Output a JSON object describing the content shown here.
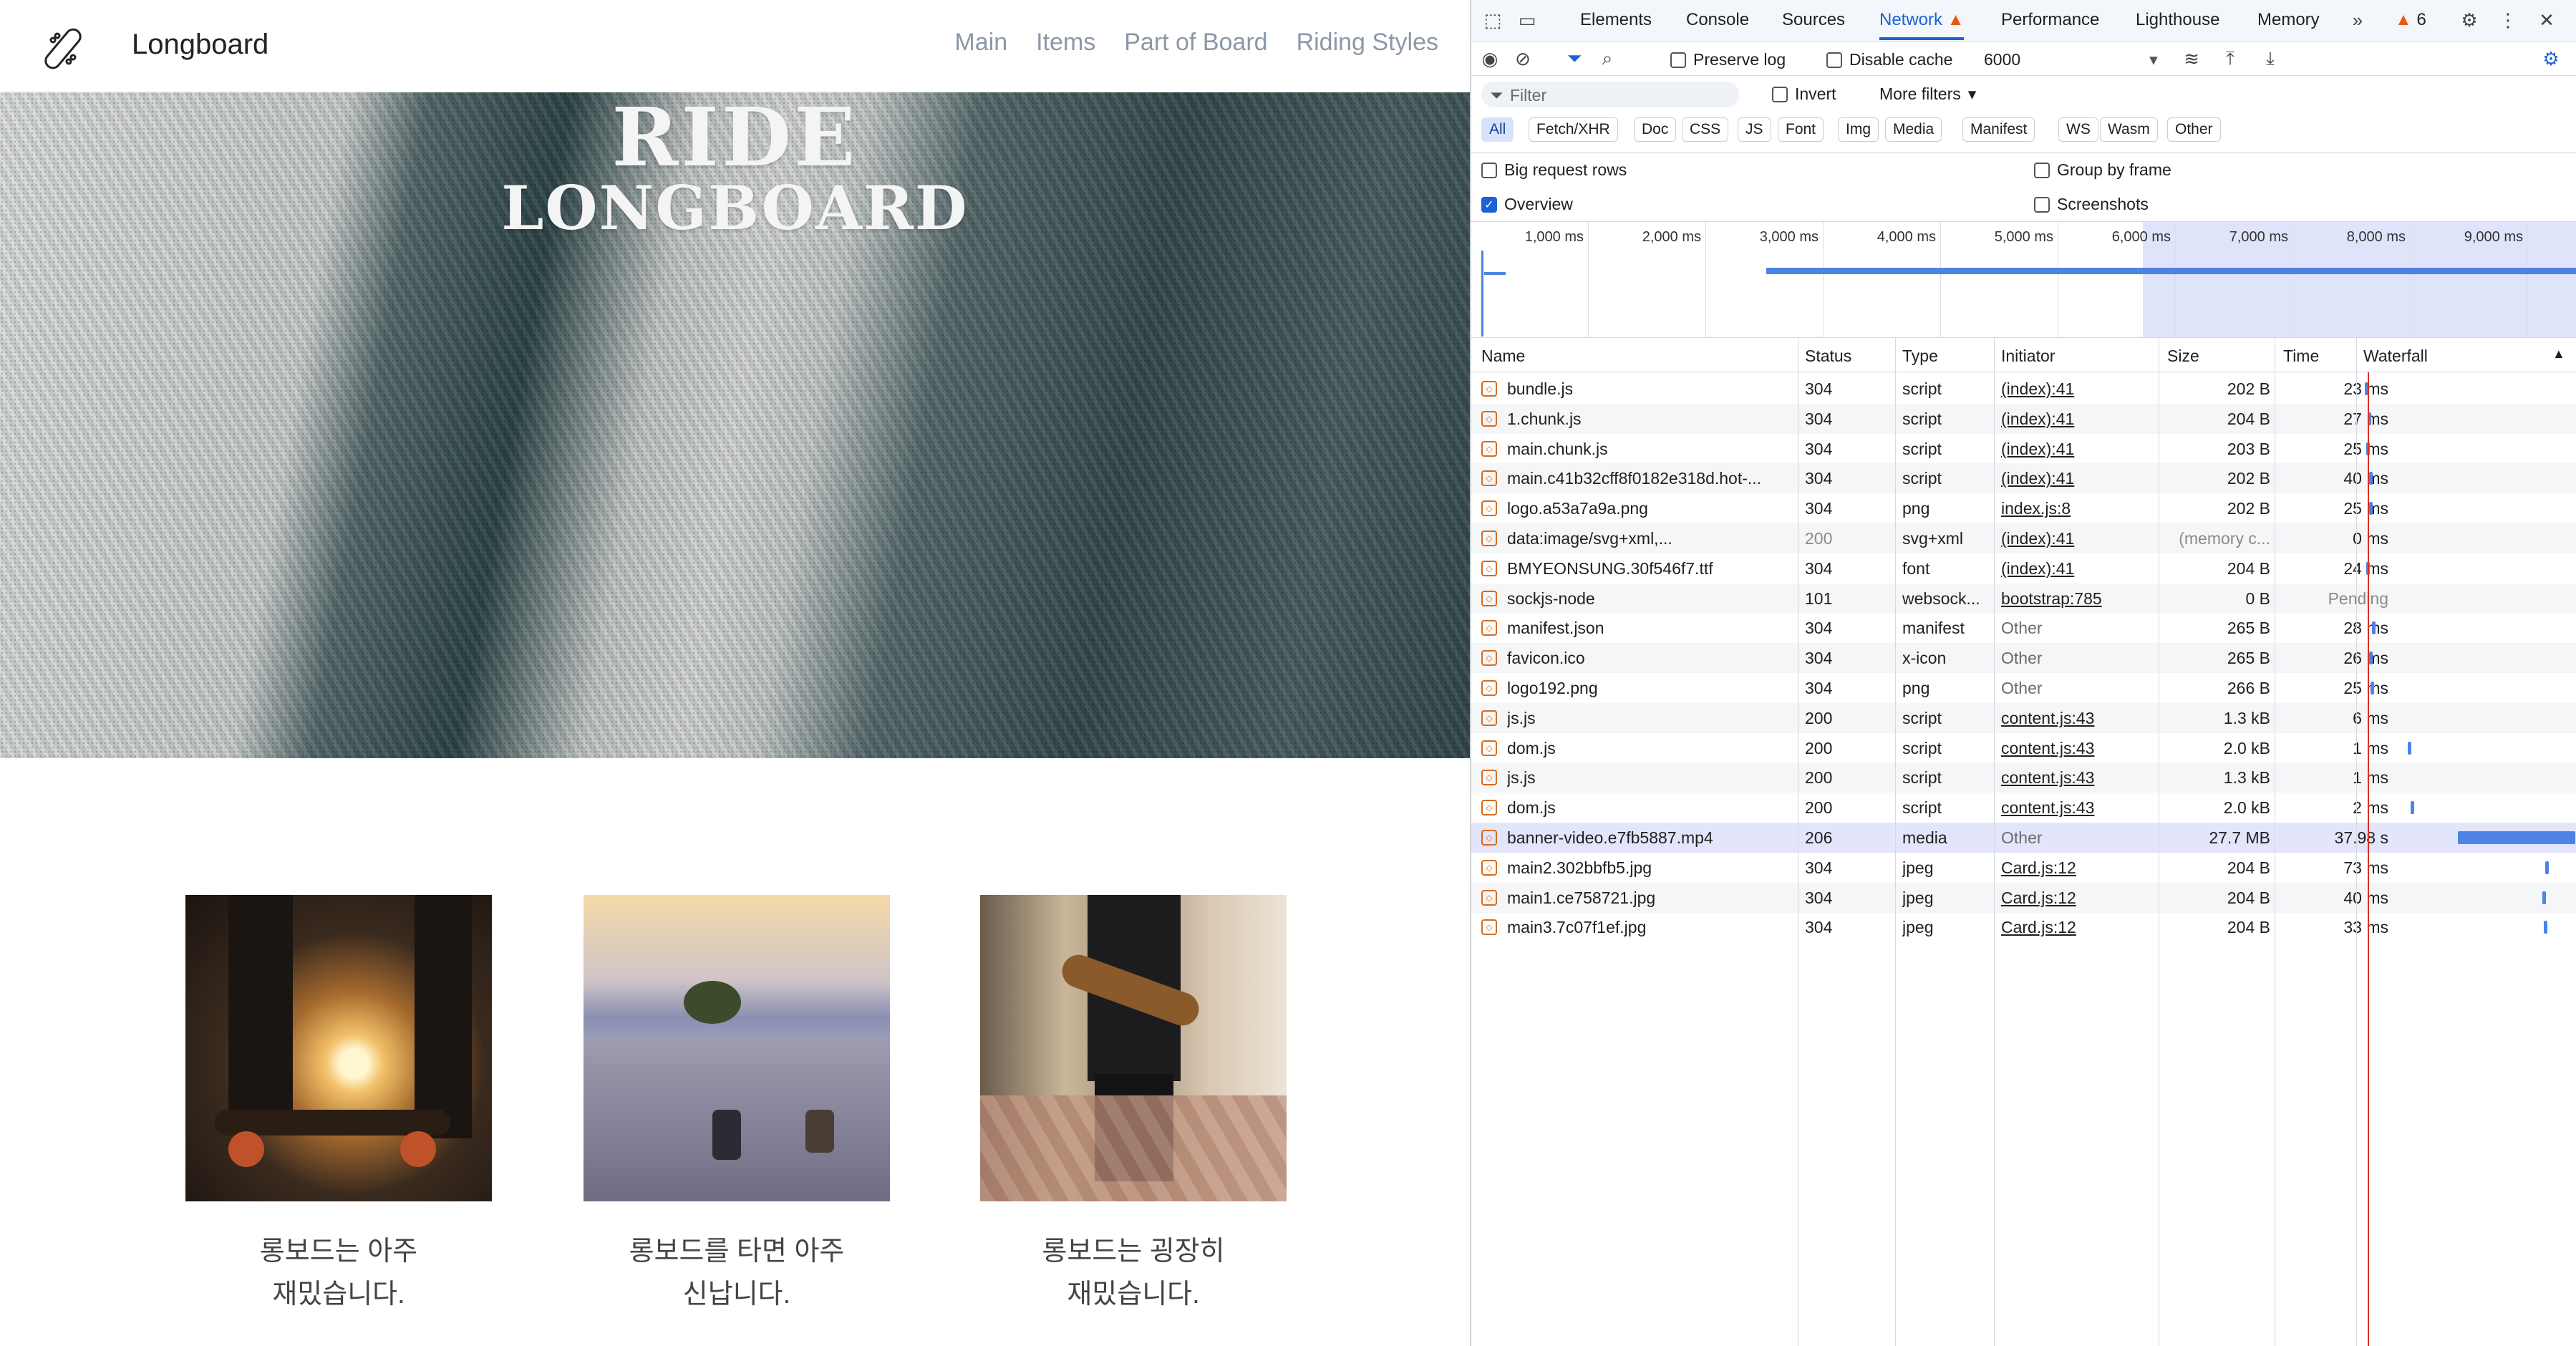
{
  "site": {
    "brand": "Longboard",
    "nav": [
      "Main",
      "Items",
      "Part of Board",
      "Riding Styles"
    ],
    "hero_line1": "RIDE",
    "hero_line2": "LONGBOARD",
    "cards": [
      {
        "caption_line1": "롱보드는 아주",
        "caption_line2": "재밌습니다."
      },
      {
        "caption_line1": "롱보드를 타면 아주",
        "caption_line2": "신납니다."
      },
      {
        "caption_line1": "롱보드는 굉장히",
        "caption_line2": "재밌습니다."
      }
    ]
  },
  "devtools": {
    "tabs": [
      "Elements",
      "Console",
      "Sources",
      "Network",
      "Performance",
      "Lighthouse",
      "Memory"
    ],
    "active_tab": "Network",
    "issue_count": "6",
    "toolbar": {
      "preserve_log": "Preserve log",
      "disable_cache": "Disable cache",
      "throttle": "6000"
    },
    "filter": {
      "placeholder": "Filter",
      "invert": "Invert",
      "more_filters": "More filters"
    },
    "types": [
      "All",
      "Fetch/XHR",
      "Doc",
      "CSS",
      "JS",
      "Font",
      "Img",
      "Media",
      "Manifest",
      "WS",
      "Wasm",
      "Other"
    ],
    "options": {
      "big_rows": "Big request rows",
      "group_frame": "Group by frame",
      "overview": "Overview",
      "screenshots": "Screenshots"
    },
    "timeline_labels": [
      "1,000 ms",
      "2,000 ms",
      "3,000 ms",
      "4,000 ms",
      "5,000 ms",
      "6,000 ms",
      "7,000 ms",
      "8,000 ms",
      "9,000 ms"
    ],
    "columns": [
      "Name",
      "Status",
      "Type",
      "Initiator",
      "Size",
      "Time",
      "Waterfall"
    ],
    "requests": [
      {
        "name": "bundle.js",
        "status": "304",
        "type": "script",
        "initiator": "(index):41",
        "size": "202 B",
        "time": "23 ms"
      },
      {
        "name": "1.chunk.js",
        "status": "304",
        "type": "script",
        "initiator": "(index):41",
        "size": "204 B",
        "time": "27 ms"
      },
      {
        "name": "main.chunk.js",
        "status": "304",
        "type": "script",
        "initiator": "(index):41",
        "size": "203 B",
        "time": "25 ms"
      },
      {
        "name": "main.c41b32cff8f0182e318d.hot-...",
        "status": "304",
        "type": "script",
        "initiator": "(index):41",
        "size": "202 B",
        "time": "40 ms"
      },
      {
        "name": "logo.a53a7a9a.png",
        "status": "304",
        "type": "png",
        "initiator": "index.js:8",
        "size": "202 B",
        "time": "25 ms"
      },
      {
        "name": "data:image/svg+xml,...",
        "status": "200",
        "type": "svg+xml",
        "initiator": "(index):41",
        "size": "(memory c...",
        "time": "0 ms"
      },
      {
        "name": "BMYEONSUNG.30f546f7.ttf",
        "status": "304",
        "type": "font",
        "initiator": "(index):41",
        "size": "204 B",
        "time": "24 ms"
      },
      {
        "name": "sockjs-node",
        "status": "101",
        "type": "websock...",
        "initiator": "bootstrap:785",
        "size": "0 B",
        "time": "Pending"
      },
      {
        "name": "manifest.json",
        "status": "304",
        "type": "manifest",
        "initiator": "Other",
        "size": "265 B",
        "time": "28 ms"
      },
      {
        "name": "favicon.ico",
        "status": "304",
        "type": "x-icon",
        "initiator": "Other",
        "size": "265 B",
        "time": "26 ms"
      },
      {
        "name": "logo192.png",
        "status": "304",
        "type": "png",
        "initiator": "Other",
        "size": "266 B",
        "time": "25 ms"
      },
      {
        "name": "js.js",
        "status": "200",
        "type": "script",
        "initiator": "content.js:43",
        "size": "1.3 kB",
        "time": "6 ms"
      },
      {
        "name": "dom.js",
        "status": "200",
        "type": "script",
        "initiator": "content.js:43",
        "size": "2.0 kB",
        "time": "1 ms"
      },
      {
        "name": "js.js",
        "status": "200",
        "type": "script",
        "initiator": "content.js:43",
        "size": "1.3 kB",
        "time": "1 ms"
      },
      {
        "name": "dom.js",
        "status": "200",
        "type": "script",
        "initiator": "content.js:43",
        "size": "2.0 kB",
        "time": "2 ms"
      },
      {
        "name": "banner-video.e7fb5887.mp4",
        "status": "206",
        "type": "media",
        "initiator": "Other",
        "size": "27.7 MB",
        "time": "37.98 s"
      },
      {
        "name": "main2.302bbfb5.jpg",
        "status": "304",
        "type": "jpeg",
        "initiator": "Card.js:12",
        "size": "204 B",
        "time": "73 ms"
      },
      {
        "name": "main1.ce758721.jpg",
        "status": "304",
        "type": "jpeg",
        "initiator": "Card.js:12",
        "size": "204 B",
        "time": "40 ms"
      },
      {
        "name": "main3.7c07f1ef.jpg",
        "status": "304",
        "type": "jpeg",
        "initiator": "Card.js:12",
        "size": "204 B",
        "time": "33 ms"
      }
    ],
    "colors": {
      "accent": "#1a62d6",
      "waterfall": "#4c84e6",
      "warning": "#e8590c"
    }
  }
}
